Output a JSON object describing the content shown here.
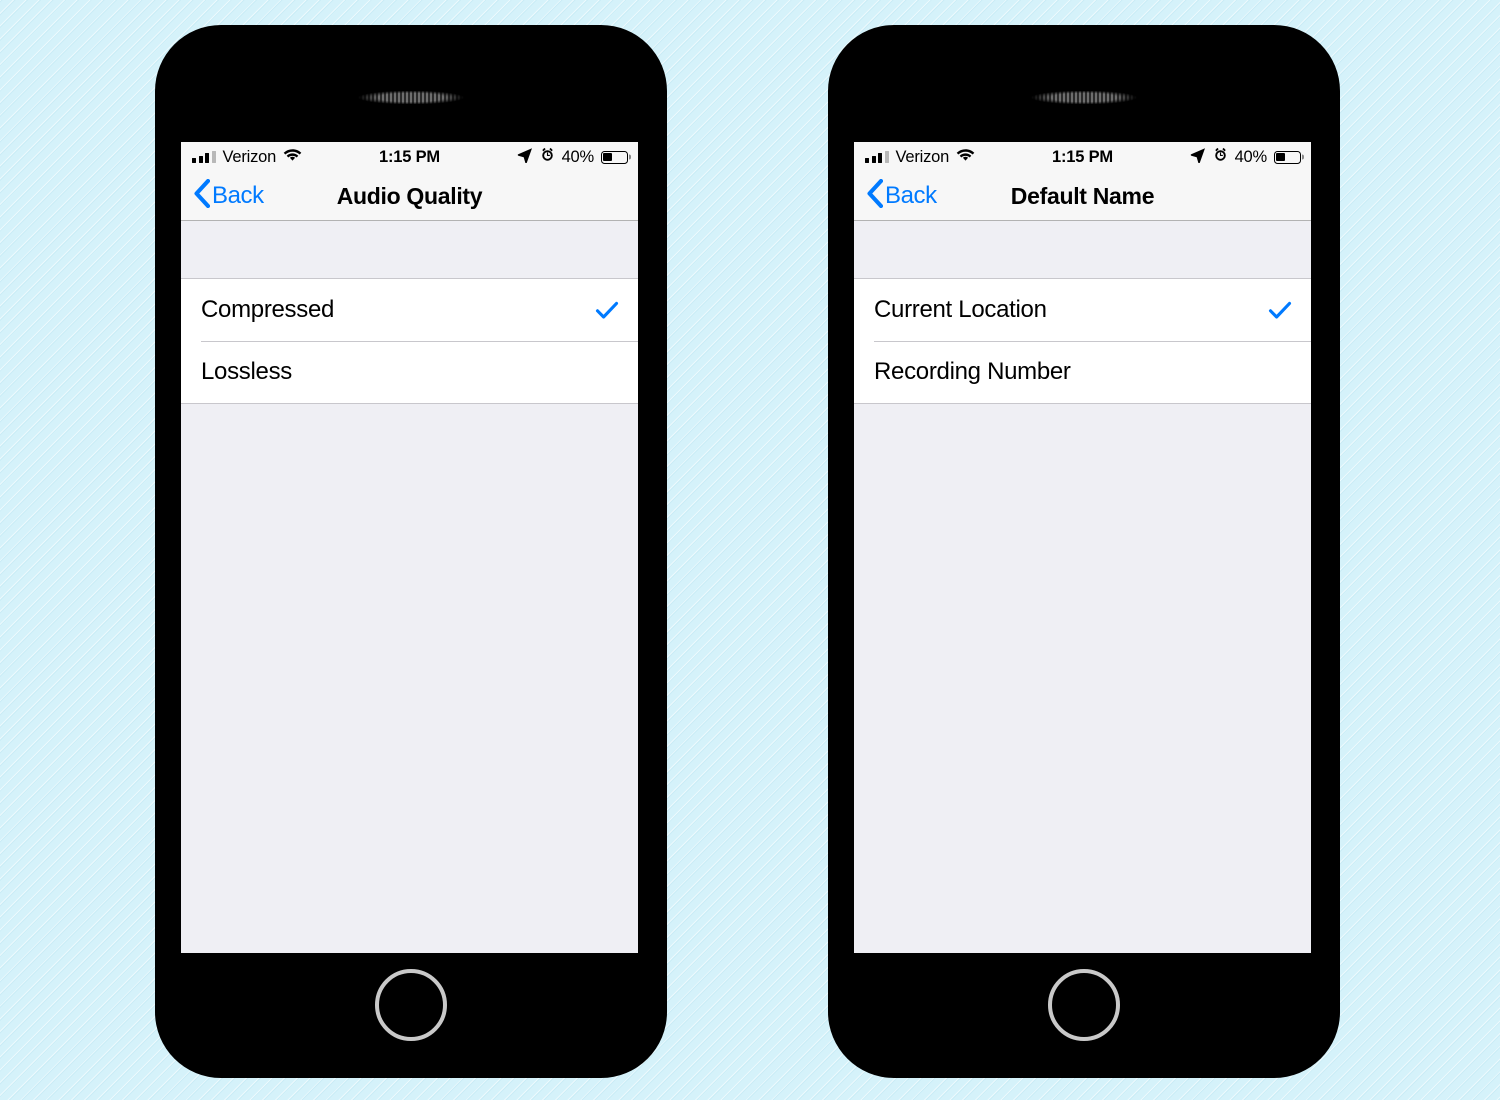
{
  "background_color": "#d5f2fa",
  "accent_color": "#007aff",
  "phones": [
    {
      "id": "audio-quality",
      "status_bar": {
        "carrier": "Verizon",
        "time": "1:15 PM",
        "battery_percent": "40%",
        "battery_level": 40,
        "signal_bars_filled": 3,
        "signal_bars_total": 4,
        "icons": [
          "signal-bars-icon",
          "wifi-icon",
          "location-arrow-icon",
          "alarm-clock-icon",
          "battery-icon"
        ]
      },
      "nav_bar": {
        "back_label": "Back",
        "title": "Audio Quality"
      },
      "options": [
        {
          "label": "Compressed",
          "selected": true
        },
        {
          "label": "Lossless",
          "selected": false
        }
      ]
    },
    {
      "id": "default-name",
      "status_bar": {
        "carrier": "Verizon",
        "time": "1:15 PM",
        "battery_percent": "40%",
        "battery_level": 40,
        "signal_bars_filled": 3,
        "signal_bars_total": 4,
        "icons": [
          "signal-bars-icon",
          "wifi-icon",
          "location-arrow-icon",
          "alarm-clock-icon",
          "battery-icon"
        ]
      },
      "nav_bar": {
        "back_label": "Back",
        "title": "Default Name"
      },
      "options": [
        {
          "label": "Current Location",
          "selected": true
        },
        {
          "label": "Recording Number",
          "selected": false
        }
      ]
    }
  ]
}
